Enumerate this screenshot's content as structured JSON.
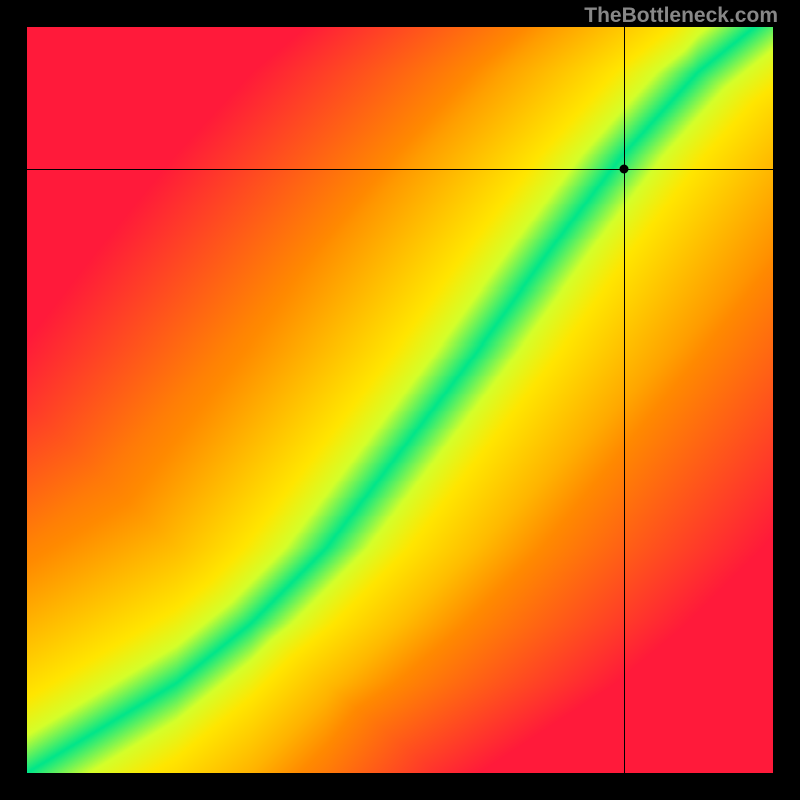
{
  "watermark": "TheBottleneck.com",
  "chart_data": {
    "type": "heatmap",
    "title": "",
    "xlabel": "",
    "ylabel": "",
    "xlim": [
      0,
      1
    ],
    "ylim": [
      0,
      1
    ],
    "colorscale": {
      "min_color": "#ff1a3a",
      "mid_low_color": "#ff8a00",
      "mid_color": "#ffe600",
      "mid_high_color": "#d4ff2a",
      "max_color": "#00e68a"
    },
    "optimal_curve": [
      {
        "x": 0.0,
        "y": 0.0
      },
      {
        "x": 0.1,
        "y": 0.06
      },
      {
        "x": 0.2,
        "y": 0.12
      },
      {
        "x": 0.3,
        "y": 0.2
      },
      {
        "x": 0.4,
        "y": 0.3
      },
      {
        "x": 0.5,
        "y": 0.43
      },
      {
        "x": 0.6,
        "y": 0.56
      },
      {
        "x": 0.7,
        "y": 0.7
      },
      {
        "x": 0.8,
        "y": 0.83
      },
      {
        "x": 0.9,
        "y": 0.94
      },
      {
        "x": 1.0,
        "y": 1.02
      }
    ],
    "band_width": 0.05,
    "crosshair": {
      "x": 0.8,
      "y": 0.81
    },
    "marker": {
      "x": 0.8,
      "y": 0.81
    }
  }
}
